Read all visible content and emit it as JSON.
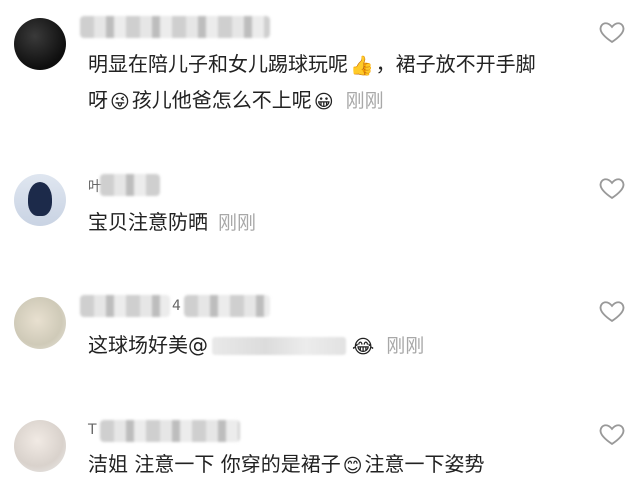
{
  "comments": [
    {
      "text_line1": "明显在陪儿子和女儿踢球玩呢",
      "emoji_1": "👍",
      "text_line1b": "，裙子放不开手脚",
      "text_line2": "呀",
      "emoji_2": "😜",
      "text_line2b": "孩儿他爸怎么不上呢",
      "emoji_3": "😀",
      "time": "刚刚"
    },
    {
      "name_prefix": "叶",
      "text": "宝贝注意防晒",
      "time": "刚刚"
    },
    {
      "name_prefix": "4",
      "text": "这球场好美@",
      "emoji": "😂",
      "time": "刚刚"
    },
    {
      "name_prefix": "T",
      "text_a": "洁姐 注意一下 你穿的是裙子",
      "emoji": "😊",
      "text_b": "注意一下姿势"
    }
  ],
  "icons": {
    "like": "heart-outline-icon"
  },
  "colors": {
    "time": "#a8a8a8",
    "text": "#222222",
    "icon": "#999999"
  }
}
